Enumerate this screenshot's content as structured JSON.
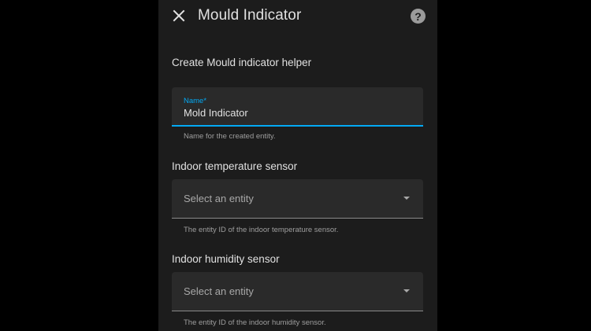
{
  "dialog": {
    "title": "Mould Indicator",
    "close_icon": "close-icon",
    "help_icon": "help-circle-icon",
    "help_glyph": "?"
  },
  "form": {
    "heading": "Create Mould indicator helper",
    "name_field": {
      "label": "Name*",
      "value": "Mold Indicator",
      "helper": "Name for the created entity."
    },
    "indoor_temperature": {
      "label": "Indoor temperature sensor",
      "placeholder": "Select an entity",
      "helper": "The entity ID of the indoor temperature sensor."
    },
    "indoor_humidity": {
      "label": "Indoor humidity sensor",
      "placeholder": "Select an entity",
      "helper": "The entity ID of the indoor humidity sensor."
    }
  },
  "colors": {
    "accent": "#03a9f4",
    "dialog_background": "#1c1c1c",
    "field_background": "#2a2a2a",
    "page_background": "#000000"
  }
}
